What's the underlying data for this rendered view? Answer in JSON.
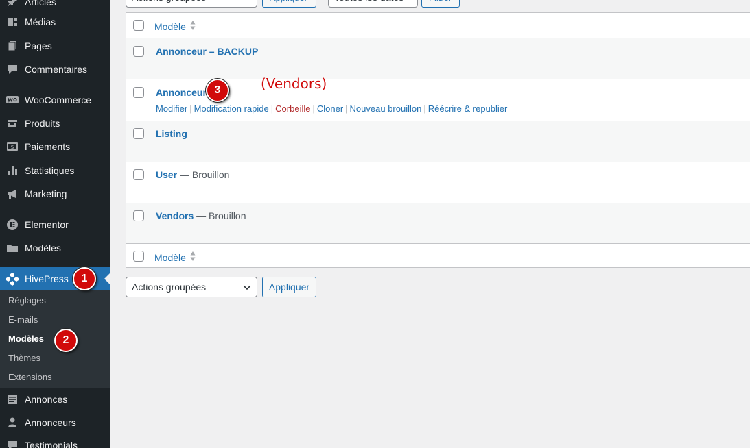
{
  "sidebar": {
    "items": [
      {
        "label": "Articles",
        "icon": "pin-icon"
      },
      {
        "label": "Médias",
        "icon": "media-icon"
      },
      {
        "label": "Pages",
        "icon": "pages-icon"
      },
      {
        "label": "Commentaires",
        "icon": "comment-icon"
      },
      {
        "label": "WooCommerce",
        "icon": "woo-icon"
      },
      {
        "label": "Produits",
        "icon": "products-icon"
      },
      {
        "label": "Paiements",
        "icon": "payments-icon"
      },
      {
        "label": "Statistiques",
        "icon": "stats-icon"
      },
      {
        "label": "Marketing",
        "icon": "megaphone-icon"
      },
      {
        "label": "Elementor",
        "icon": "elementor-icon"
      },
      {
        "label": "Modèles",
        "icon": "folder-icon"
      },
      {
        "label": "HivePress",
        "icon": "hivepress-icon"
      },
      {
        "label": "Annonces",
        "icon": "listing-icon"
      },
      {
        "label": "Annonceurs",
        "icon": "user-icon"
      },
      {
        "label": "Testimonials",
        "icon": "testimonial-icon"
      }
    ],
    "submenu": [
      "Réglages",
      "E-mails",
      "Modèles",
      "Thèmes",
      "Extensions"
    ]
  },
  "badges": {
    "b1": "1",
    "b2": "2",
    "b3": "3"
  },
  "top_controls": {
    "bulk_select": "Actions groupées",
    "apply": "Appliquer",
    "dates_select": "Toutes les dates",
    "filter": "Filtrer"
  },
  "table": {
    "column_header": "Modèle",
    "rows": [
      {
        "title": "Annonceur – BACKUP",
        "state": ""
      },
      {
        "title": "Annonceur",
        "state": ""
      },
      {
        "title": "Listing",
        "state": ""
      },
      {
        "title": "User",
        "state": " — Brouillon"
      },
      {
        "title": "Vendors",
        "state": " — Brouillon"
      }
    ],
    "row_actions": [
      "Modifier",
      "Modification rapide",
      "Corbeille",
      "Cloner",
      "Nouveau brouillon",
      "Réécrire & republier"
    ],
    "annotation": "(Vendors)"
  },
  "bottom_controls": {
    "bulk_select": "Actions groupées",
    "apply": "Appliquer"
  },
  "colors": {
    "sidebar_bg": "#1d2327",
    "accent": "#2271b1",
    "badge": "#d10a0a",
    "trash": "#b32d2e"
  }
}
